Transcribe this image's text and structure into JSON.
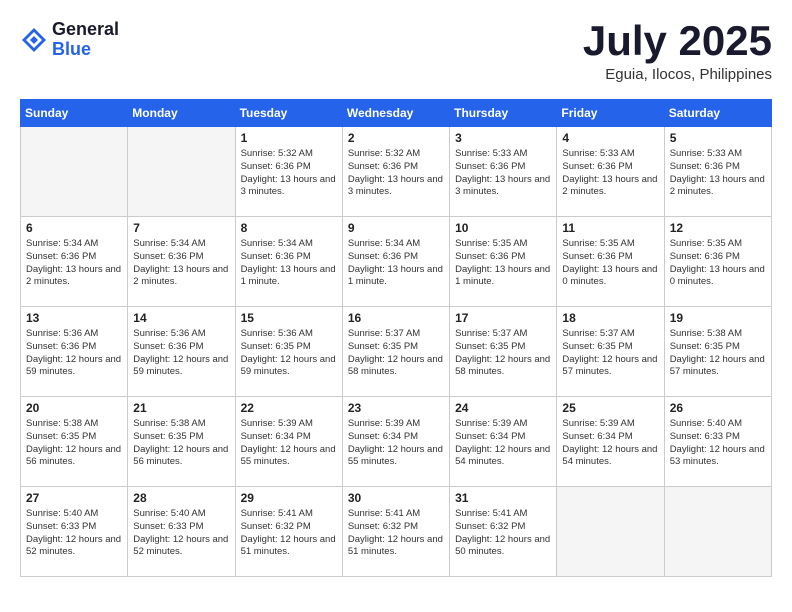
{
  "header": {
    "logo_general": "General",
    "logo_blue": "Blue",
    "month_year": "July 2025",
    "location": "Eguia, Ilocos, Philippines"
  },
  "days_of_week": [
    "Sunday",
    "Monday",
    "Tuesday",
    "Wednesday",
    "Thursday",
    "Friday",
    "Saturday"
  ],
  "weeks": [
    [
      {
        "day": "",
        "info": ""
      },
      {
        "day": "",
        "info": ""
      },
      {
        "day": "1",
        "info": "Sunrise: 5:32 AM\nSunset: 6:36 PM\nDaylight: 13 hours and 3 minutes."
      },
      {
        "day": "2",
        "info": "Sunrise: 5:32 AM\nSunset: 6:36 PM\nDaylight: 13 hours and 3 minutes."
      },
      {
        "day": "3",
        "info": "Sunrise: 5:33 AM\nSunset: 6:36 PM\nDaylight: 13 hours and 3 minutes."
      },
      {
        "day": "4",
        "info": "Sunrise: 5:33 AM\nSunset: 6:36 PM\nDaylight: 13 hours and 2 minutes."
      },
      {
        "day": "5",
        "info": "Sunrise: 5:33 AM\nSunset: 6:36 PM\nDaylight: 13 hours and 2 minutes."
      }
    ],
    [
      {
        "day": "6",
        "info": "Sunrise: 5:34 AM\nSunset: 6:36 PM\nDaylight: 13 hours and 2 minutes."
      },
      {
        "day": "7",
        "info": "Sunrise: 5:34 AM\nSunset: 6:36 PM\nDaylight: 13 hours and 2 minutes."
      },
      {
        "day": "8",
        "info": "Sunrise: 5:34 AM\nSunset: 6:36 PM\nDaylight: 13 hours and 1 minute."
      },
      {
        "day": "9",
        "info": "Sunrise: 5:34 AM\nSunset: 6:36 PM\nDaylight: 13 hours and 1 minute."
      },
      {
        "day": "10",
        "info": "Sunrise: 5:35 AM\nSunset: 6:36 PM\nDaylight: 13 hours and 1 minute."
      },
      {
        "day": "11",
        "info": "Sunrise: 5:35 AM\nSunset: 6:36 PM\nDaylight: 13 hours and 0 minutes."
      },
      {
        "day": "12",
        "info": "Sunrise: 5:35 AM\nSunset: 6:36 PM\nDaylight: 13 hours and 0 minutes."
      }
    ],
    [
      {
        "day": "13",
        "info": "Sunrise: 5:36 AM\nSunset: 6:36 PM\nDaylight: 12 hours and 59 minutes."
      },
      {
        "day": "14",
        "info": "Sunrise: 5:36 AM\nSunset: 6:36 PM\nDaylight: 12 hours and 59 minutes."
      },
      {
        "day": "15",
        "info": "Sunrise: 5:36 AM\nSunset: 6:35 PM\nDaylight: 12 hours and 59 minutes."
      },
      {
        "day": "16",
        "info": "Sunrise: 5:37 AM\nSunset: 6:35 PM\nDaylight: 12 hours and 58 minutes."
      },
      {
        "day": "17",
        "info": "Sunrise: 5:37 AM\nSunset: 6:35 PM\nDaylight: 12 hours and 58 minutes."
      },
      {
        "day": "18",
        "info": "Sunrise: 5:37 AM\nSunset: 6:35 PM\nDaylight: 12 hours and 57 minutes."
      },
      {
        "day": "19",
        "info": "Sunrise: 5:38 AM\nSunset: 6:35 PM\nDaylight: 12 hours and 57 minutes."
      }
    ],
    [
      {
        "day": "20",
        "info": "Sunrise: 5:38 AM\nSunset: 6:35 PM\nDaylight: 12 hours and 56 minutes."
      },
      {
        "day": "21",
        "info": "Sunrise: 5:38 AM\nSunset: 6:35 PM\nDaylight: 12 hours and 56 minutes."
      },
      {
        "day": "22",
        "info": "Sunrise: 5:39 AM\nSunset: 6:34 PM\nDaylight: 12 hours and 55 minutes."
      },
      {
        "day": "23",
        "info": "Sunrise: 5:39 AM\nSunset: 6:34 PM\nDaylight: 12 hours and 55 minutes."
      },
      {
        "day": "24",
        "info": "Sunrise: 5:39 AM\nSunset: 6:34 PM\nDaylight: 12 hours and 54 minutes."
      },
      {
        "day": "25",
        "info": "Sunrise: 5:39 AM\nSunset: 6:34 PM\nDaylight: 12 hours and 54 minutes."
      },
      {
        "day": "26",
        "info": "Sunrise: 5:40 AM\nSunset: 6:33 PM\nDaylight: 12 hours and 53 minutes."
      }
    ],
    [
      {
        "day": "27",
        "info": "Sunrise: 5:40 AM\nSunset: 6:33 PM\nDaylight: 12 hours and 52 minutes."
      },
      {
        "day": "28",
        "info": "Sunrise: 5:40 AM\nSunset: 6:33 PM\nDaylight: 12 hours and 52 minutes."
      },
      {
        "day": "29",
        "info": "Sunrise: 5:41 AM\nSunset: 6:32 PM\nDaylight: 12 hours and 51 minutes."
      },
      {
        "day": "30",
        "info": "Sunrise: 5:41 AM\nSunset: 6:32 PM\nDaylight: 12 hours and 51 minutes."
      },
      {
        "day": "31",
        "info": "Sunrise: 5:41 AM\nSunset: 6:32 PM\nDaylight: 12 hours and 50 minutes."
      },
      {
        "day": "",
        "info": ""
      },
      {
        "day": "",
        "info": ""
      }
    ]
  ]
}
